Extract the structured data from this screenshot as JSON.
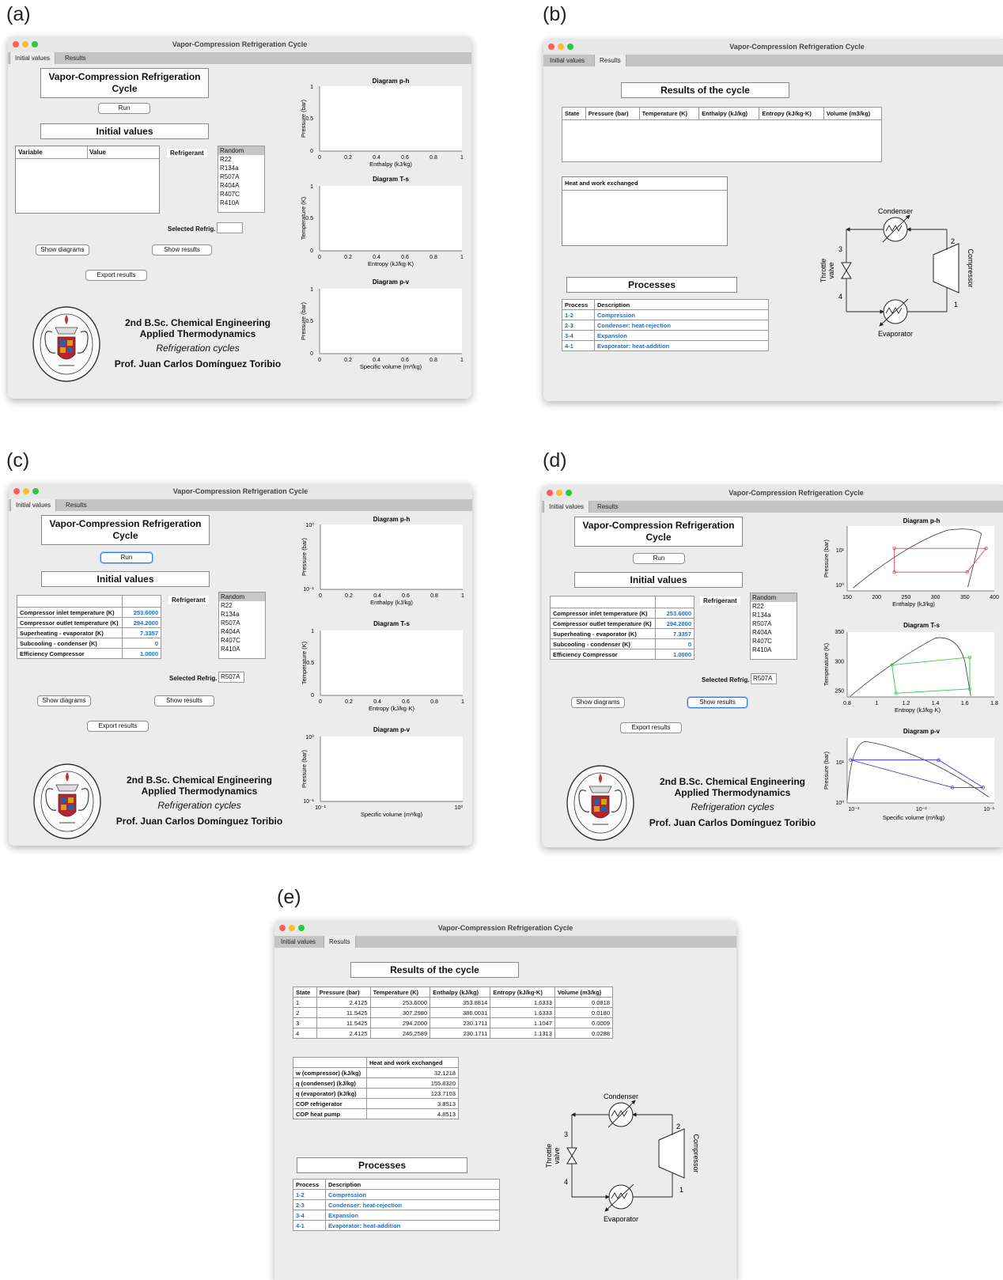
{
  "panel_labels": [
    "(a)",
    "(b)",
    "(c)",
    "(d)",
    "(e)"
  ],
  "window_title": "Vapor-Compression Refrigeration Cycle",
  "tabs": [
    "Initial values",
    "Results"
  ],
  "initial_tab": {
    "app_title_line1": "Vapor-Compression Refrigeration",
    "app_title_line2": "Cycle",
    "run_label": "Run",
    "initial_values_title": "Initial values",
    "variable_header": "Variable",
    "value_header": "Value",
    "refrigerant_label": "Refrigerant",
    "refrigerants": [
      "Random",
      "R22",
      "R134a",
      "R507A",
      "R404A",
      "R407C",
      "R410A"
    ],
    "selected_refrig_label": "Selected Refrig.",
    "selected_refrig_value": "R507A",
    "show_diagrams_label": "Show diagrams",
    "show_results_label": "Show results",
    "export_results_label": "Export results",
    "inputs": [
      {
        "name": "Compressor inlet temperature (K)",
        "value": "253.6000"
      },
      {
        "name": "Compressor outlet temperature (K)",
        "value": "294.2000"
      },
      {
        "name": "Superheating - evaporator (K)",
        "value": "7.3357"
      },
      {
        "name": "Subcooling - condenser (K)",
        "value": "0"
      },
      {
        "name": "Efficiency Compressor",
        "value": "1.0000"
      }
    ],
    "credits": {
      "line1": "2nd B.Sc. Chemical Engineering",
      "line2": "Applied Thermodynamics",
      "line3": "Refrigeration cycles",
      "line4": "Prof. Juan Carlos Domínguez Toribio"
    },
    "seal_text_top": "UNIVERSITAS COMPLUTENSIS",
    "seal_text_bottom": "MATRITENSIS"
  },
  "results_tab": {
    "results_title": "Results of the cycle",
    "state_headers": [
      "State",
      "Pressure (bar)",
      "Temperature (K)",
      "Enthalpy (kJ/kg)",
      "Entropy (kJ/kg·K)",
      "Volume (m3/kg)"
    ],
    "states": [
      [
        "1",
        "2.4125",
        "253.6000",
        "353.8814",
        "1.6333",
        "0.0818"
      ],
      [
        "2",
        "11.5425",
        "307.2980",
        "386.0031",
        "1.6333",
        "0.0180"
      ],
      [
        "3",
        "11.5425",
        "294.2000",
        "230.1711",
        "1.1047",
        "0.0009"
      ],
      [
        "4",
        "2.4125",
        "246.2589",
        "230.1711",
        "1.1313",
        "0.0288"
      ]
    ],
    "heat_work_header": "Heat and work exchanged",
    "heat_work": [
      {
        "name": "w (compressor) (kJ/kg)",
        "value": "32.1218"
      },
      {
        "name": "q (condenser) (kJ/kg)",
        "value": "155.8320"
      },
      {
        "name": "q (evaporator) (kJ/kg)",
        "value": "123.7103"
      },
      {
        "name": "COP refrigerator",
        "value": "3.8513"
      },
      {
        "name": "COP heat pump",
        "value": "4.8513"
      }
    ],
    "processes_title": "Processes",
    "process_headers": [
      "Process",
      "Description"
    ],
    "processes": [
      {
        "id": "1-2",
        "desc": "Compression"
      },
      {
        "id": "2-3",
        "desc": "Condenser: heat-rejection"
      },
      {
        "id": "3-4",
        "desc": "Expansion"
      },
      {
        "id": "4-1",
        "desc": "Evaporator: heat-addition"
      }
    ],
    "schematic": {
      "condenser": "Condenser",
      "evaporator": "Evaporator",
      "compressor": "Compressor",
      "throttle_line1": "Throttle",
      "throttle_line2": "valve",
      "points": [
        "1",
        "2",
        "3",
        "4"
      ]
    }
  },
  "diagrams": {
    "ph": {
      "title": "Diagram p-h",
      "xlabel": "Enthalpy (kJ/kg)",
      "ylabel": "Pressure (bar)"
    },
    "ts": {
      "title": "Diagram T-s",
      "xlabel": "Entropy (kJ/kg·K)",
      "ylabel": "Temperature (K)"
    },
    "pv": {
      "title": "Diagram p-v",
      "xlabel": "Specific volume (m³/kg)",
      "ylabel": "Pressure (bar)"
    },
    "linear_ticks": [
      "0",
      "0.2",
      "0.4",
      "0.6",
      "0.8",
      "1"
    ],
    "y_ticks": [
      "0",
      "0.5",
      "1"
    ],
    "log_ticks_y": [
      "10⁻¹",
      "10⁰"
    ],
    "log_ticks_x": [
      "10⁻¹",
      "10⁰"
    ],
    "d_ph_xticks": [
      "150",
      "200",
      "250",
      "300",
      "350",
      "400"
    ],
    "d_ph_yticks": [
      "10⁰",
      "10¹"
    ],
    "d_ts_xticks": [
      "0.8",
      "1",
      "1.2",
      "1.4",
      "1.6",
      "1.8"
    ],
    "d_ts_yticks": [
      "250",
      "300",
      "350"
    ],
    "d_pv_xticks": [
      "10⁻³",
      "10⁻²",
      "10⁻¹"
    ],
    "d_pv_yticks": [
      "10⁰",
      "10¹"
    ],
    "cycle_colors": {
      "ph": "#e8424b",
      "ts": "#2ecc40",
      "pv": "#3d3dd8",
      "dome": "#333333"
    }
  },
  "chart_data": [
    {
      "type": "line",
      "title": "Diagram p-h",
      "xlabel": "Enthalpy (kJ/kg)",
      "ylabel": "Pressure (bar)",
      "xlim": [
        150,
        400
      ],
      "ylog": true,
      "series": [
        {
          "x": [
            353.9,
            386.0,
            230.2,
            230.2,
            353.9
          ],
          "y": [
            2.4125,
            11.5425,
            11.5425,
            2.4125,
            2.4125
          ]
        }
      ]
    },
    {
      "type": "line",
      "title": "Diagram T-s",
      "xlabel": "Entropy (kJ/kg·K)",
      "ylabel": "Temperature (K)",
      "xlim": [
        0.8,
        1.8
      ],
      "ylim": [
        240,
        350
      ],
      "series": [
        {
          "x": [
            1.6333,
            1.6333,
            1.1047,
            1.1313,
            1.6333
          ],
          "y": [
            253.6,
            307.298,
            294.2,
            246.2589,
            253.6
          ]
        }
      ]
    },
    {
      "type": "line",
      "title": "Diagram p-v",
      "xlabel": "Specific volume (m³/kg)",
      "ylabel": "Pressure (bar)",
      "xlog": true,
      "ylog": true,
      "series": [
        {
          "x": [
            0.0818,
            0.018,
            0.0009,
            0.0288,
            0.0818
          ],
          "y": [
            2.4125,
            11.5425,
            11.5425,
            2.4125,
            2.4125
          ]
        }
      ]
    }
  ]
}
